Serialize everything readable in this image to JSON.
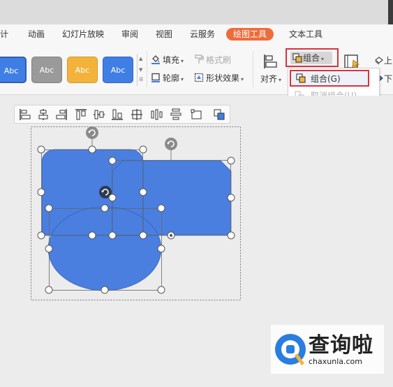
{
  "menu": {
    "tabs": [
      {
        "label": "设计",
        "visible_text": "计"
      },
      {
        "label": "动画"
      },
      {
        "label": "幻灯片放映"
      },
      {
        "label": "审阅"
      },
      {
        "label": "视图"
      },
      {
        "label": "云服务"
      },
      {
        "label": "绘图工具",
        "active": true
      },
      {
        "label": "文本工具"
      }
    ],
    "active_color": "#ee6c3c"
  },
  "ribbon": {
    "styles": [
      {
        "label": "Abc",
        "color": "#3f7fe5"
      },
      {
        "label": "Abc",
        "color": "#9a9a9a"
      },
      {
        "label": "Abc",
        "color": "#f3b33b"
      },
      {
        "label": "Abc",
        "color": "#3f7fe5"
      }
    ],
    "fill_label": "填充",
    "format_painter_label": "格式刷",
    "outline_label": "轮廓",
    "shape_effects_label": "形状效果",
    "align_label": "对齐",
    "group_label": "组合",
    "right_edge_labels": [
      "上",
      "下"
    ]
  },
  "group_dropdown": {
    "group_item": "组合(G)",
    "ungroup_item": "取消组合(U)"
  },
  "highlight_color": "#d9323e",
  "shape_color": "#4a7fe0",
  "watermark": {
    "text": "查询啦",
    "url": "chaxunla.com"
  }
}
